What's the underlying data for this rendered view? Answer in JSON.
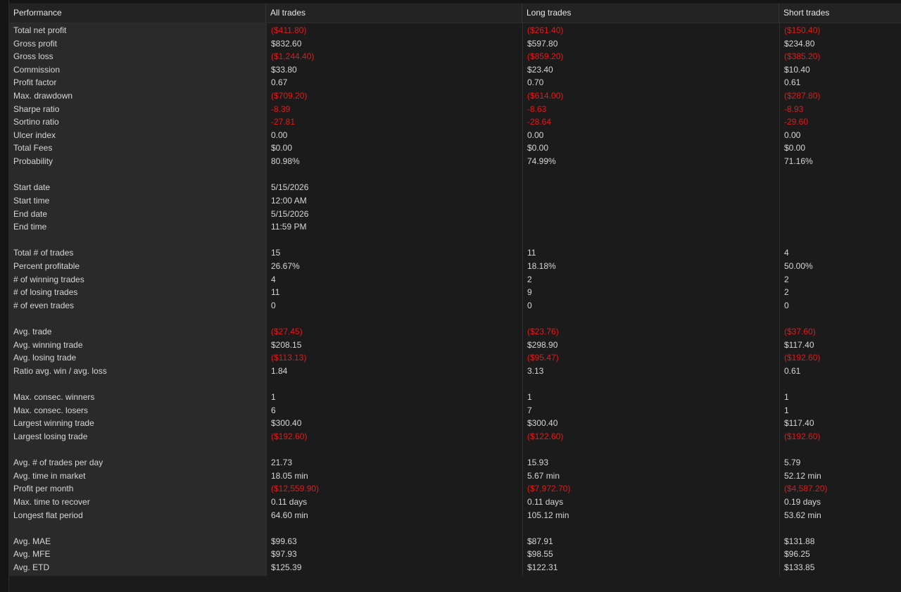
{
  "header": {
    "performance": "Performance",
    "all": "All trades",
    "long": "Long trades",
    "short": "Short trades"
  },
  "rows": [
    {
      "label": "Total net profit",
      "all": "($411.80)",
      "long": "($261.40)",
      "short": "($150.40)",
      "neg": true
    },
    {
      "label": "Gross profit",
      "all": "$832.60",
      "long": "$597.80",
      "short": "$234.80"
    },
    {
      "label": "Gross loss",
      "all": "($1,244.40)",
      "long": "($859.20)",
      "short": "($385.20)",
      "neg": true
    },
    {
      "label": "Commission",
      "all": "$33.80",
      "long": "$23.40",
      "short": "$10.40"
    },
    {
      "label": "Profit factor",
      "all": "0.67",
      "long": "0.70",
      "short": "0.61"
    },
    {
      "label": "Max. drawdown",
      "all": "($709.20)",
      "long": "($614.00)",
      "short": "($287.80)",
      "neg": true
    },
    {
      "label": "Sharpe ratio",
      "all": "-8.39",
      "long": "-8.63",
      "short": "-8.93",
      "neg": true
    },
    {
      "label": "Sortino ratio",
      "all": "-27.81",
      "long": "-28.64",
      "short": "-29.60",
      "neg": true
    },
    {
      "label": "Ulcer index",
      "all": "0.00",
      "long": "0.00",
      "short": "0.00"
    },
    {
      "label": "Total Fees",
      "all": "$0.00",
      "long": "$0.00",
      "short": "$0.00"
    },
    {
      "label": "Probability",
      "all": "80.98%",
      "long": "74.99%",
      "short": "71.16%"
    },
    {
      "label": "",
      "all": "",
      "long": "",
      "short": ""
    },
    {
      "label": "Start date",
      "all": "5/15/2026",
      "long": "",
      "short": ""
    },
    {
      "label": "Start time",
      "all": "12:00 AM",
      "long": "",
      "short": ""
    },
    {
      "label": "End date",
      "all": "5/15/2026",
      "long": "",
      "short": ""
    },
    {
      "label": "End time",
      "all": "11:59 PM",
      "long": "",
      "short": ""
    },
    {
      "label": "",
      "all": "",
      "long": "",
      "short": ""
    },
    {
      "label": "Total # of trades",
      "all": "15",
      "long": "11",
      "short": "4"
    },
    {
      "label": "Percent profitable",
      "all": "26.67%",
      "long": "18.18%",
      "short": "50.00%"
    },
    {
      "label": "# of winning trades",
      "all": "4",
      "long": "2",
      "short": "2"
    },
    {
      "label": "# of losing trades",
      "all": "11",
      "long": "9",
      "short": "2"
    },
    {
      "label": "# of even trades",
      "all": "0",
      "long": "0",
      "short": "0"
    },
    {
      "label": "",
      "all": "",
      "long": "",
      "short": ""
    },
    {
      "label": "Avg. trade",
      "all": "($27.45)",
      "long": "($23.76)",
      "short": "($37.60)",
      "neg": true
    },
    {
      "label": "Avg. winning trade",
      "all": "$208.15",
      "long": "$298.90",
      "short": "$117.40"
    },
    {
      "label": "Avg. losing trade",
      "all": "($113.13)",
      "long": "($95.47)",
      "short": "($192.60)",
      "neg": true
    },
    {
      "label": "Ratio avg. win / avg. loss",
      "all": "1.84",
      "long": "3.13",
      "short": "0.61"
    },
    {
      "label": "",
      "all": "",
      "long": "",
      "short": ""
    },
    {
      "label": "Max. consec. winners",
      "all": "1",
      "long": "1",
      "short": "1"
    },
    {
      "label": "Max. consec. losers",
      "all": "6",
      "long": "7",
      "short": "1"
    },
    {
      "label": "Largest winning trade",
      "all": "$300.40",
      "long": "$300.40",
      "short": "$117.40"
    },
    {
      "label": "Largest losing trade",
      "all": "($192.60)",
      "long": "($122.60)",
      "short": "($192.60)",
      "neg": true
    },
    {
      "label": "",
      "all": "",
      "long": "",
      "short": ""
    },
    {
      "label": "Avg. # of trades per day",
      "all": "21.73",
      "long": "15.93",
      "short": "5.79"
    },
    {
      "label": "Avg. time in market",
      "all": "18.05 min",
      "long": "5.67 min",
      "short": "52.12 min"
    },
    {
      "label": "Profit per month",
      "all": "($12,559.90)",
      "long": "($7,972.70)",
      "short": "($4,587.20)",
      "neg": true
    },
    {
      "label": "Max. time to recover",
      "all": "0.11 days",
      "long": "0.11 days",
      "short": "0.19 days"
    },
    {
      "label": "Longest flat period",
      "all": "64.60 min",
      "long": "105.12 min",
      "short": "53.62 min"
    },
    {
      "label": "",
      "all": "",
      "long": "",
      "short": ""
    },
    {
      "label": "Avg. MAE",
      "all": "$99.63",
      "long": "$87.91",
      "short": "$131.88"
    },
    {
      "label": "Avg. MFE",
      "all": "$97.93",
      "long": "$98.55",
      "short": "$96.25"
    },
    {
      "label": "Avg. ETD",
      "all": "$125.39",
      "long": "$122.31",
      "short": "$133.85"
    }
  ],
  "colors": {
    "negative": "#e21a1a",
    "text": "#d6d6d6",
    "label_bg": "#2a2a2a",
    "background": "#1b1b1b"
  }
}
